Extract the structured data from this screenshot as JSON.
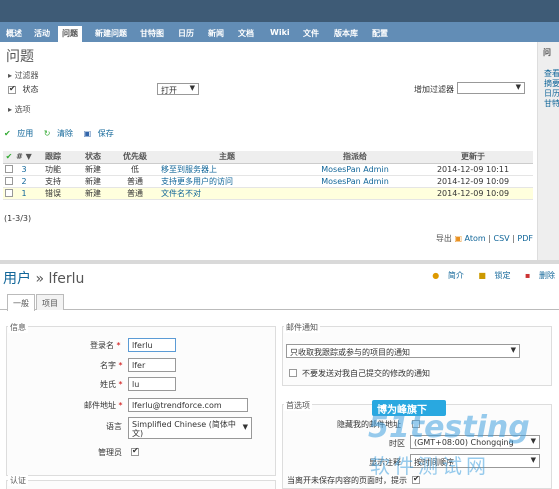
{
  "nav": {
    "tabs": [
      "概述",
      "活动",
      "问题",
      "新建问题",
      "甘特图",
      "日历",
      "新闻",
      "文档",
      "Wiki",
      "文件",
      "版本库",
      "配置"
    ],
    "selected_index": 2
  },
  "issues_page": {
    "title": "问题",
    "filters_legend": "过滤器",
    "status_label": "状态",
    "status_value": "打开",
    "add_filter_label": "增加过滤器",
    "options_legend": "选项",
    "apply_label": "应用",
    "clear_label": "清除",
    "save_label": "保存",
    "columns": [
      "#",
      "跟踪",
      "状态",
      "优先级",
      "主题",
      "指派给",
      "更新于"
    ],
    "rows": [
      {
        "id": "3",
        "tracker": "功能",
        "status": "新建",
        "priority": "低",
        "subject": "移至到服务器上",
        "assignee": "MosesPan Admin",
        "updated": "2014-12-09 10:11",
        "highlight": false
      },
      {
        "id": "2",
        "tracker": "支持",
        "status": "新建",
        "priority": "普通",
        "subject": "支持更多用户的访问",
        "assignee": "MosesPan Admin",
        "updated": "2014-12-09 10:09",
        "highlight": false
      },
      {
        "id": "1",
        "tracker": "错误",
        "status": "新建",
        "priority": "普通",
        "subject": "文件名不对",
        "assignee": "",
        "updated": "2014-12-09 10:09",
        "highlight": true
      }
    ],
    "count_text": "(1-3/3)",
    "export_label": "导出",
    "export_atom": "Atom",
    "export_csv": "CSV",
    "export_pdf": "PDF",
    "sidebar_title": "问",
    "sidebar_links": [
      "查看",
      "摘要",
      "日历",
      "甘特"
    ]
  },
  "user_page": {
    "title_prefix": "用户",
    "title_user": "lferlu",
    "actions": [
      "简介",
      "锁定",
      "删除"
    ],
    "tabs": [
      "一般",
      "项目"
    ],
    "info_legend": "信息",
    "login_label": "登录名",
    "login_value": "lferlu",
    "firstname_label": "名字",
    "firstname_value": "lfer",
    "lastname_label": "姓氏",
    "lastname_value": "lu",
    "email_label": "邮件地址",
    "email_value": "lferlu@trendforce.com",
    "language_label": "语言",
    "language_value": "Simplified Chinese (简体中文)",
    "admin_label": "管理员",
    "auth_legend": "认证",
    "mail_legend": "邮件通知",
    "mail_value": "只收取我跟踪或参与的项目的通知",
    "no_self_label": "不要发送对我自己提交的修改的通知",
    "prefs_legend": "首选项",
    "hide_email_label": "隐藏我的邮件地址",
    "timezone_label": "时区",
    "timezone_value": "(GMT+08:00) Chongqing",
    "comments_label": "显示注释",
    "comments_value": "按时间顺序",
    "warn_label": "当离开未保存内容的页面时，提示"
  },
  "watermark": {
    "line1": "博为峰旗下",
    "line2": "51testing",
    "line3": "软件测试网"
  }
}
